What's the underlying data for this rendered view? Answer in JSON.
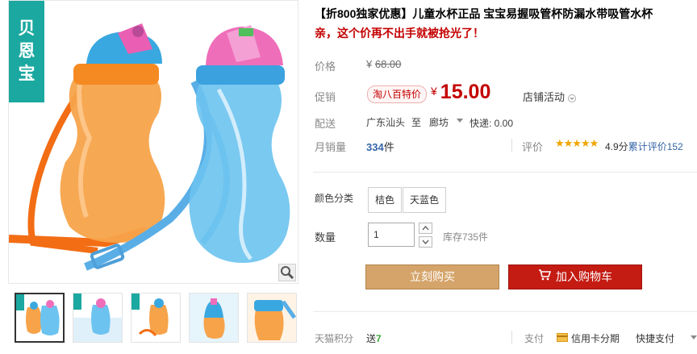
{
  "brand": {
    "chars": [
      "贝",
      "恩",
      "宝"
    ]
  },
  "product": {
    "title_prefix": "【折800独家优惠】",
    "title_main": "儿童水杯正品 宝宝易握吸管杯防漏水带吸管水杯",
    "subtitle": "亲，这个价再不出手就被抢光了！"
  },
  "price": {
    "label": "价格",
    "currency": "¥",
    "original": "68.00"
  },
  "promo": {
    "label": "促销",
    "badge": "淘八百特价",
    "currency": "¥",
    "value": "15.00",
    "shop_activity": "店铺活动"
  },
  "shipping": {
    "label": "配送",
    "from": "广东汕头",
    "to": "至",
    "city": "廊坊",
    "fee": "快递: 0.00"
  },
  "sales": {
    "label": "月销量",
    "count": "334",
    "unit": "件"
  },
  "reviews": {
    "label": "评价",
    "stars": "★★★★★",
    "score": "4.9分",
    "count_text": "累计评价152"
  },
  "color": {
    "label": "颜色分类",
    "options": [
      "桔色",
      "天蓝色"
    ]
  },
  "quantity": {
    "label": "数量",
    "value": "1",
    "stock": "库存735件"
  },
  "actions": {
    "buy_now": "立刻购买",
    "add_to_cart": "加入购物车"
  },
  "points": {
    "label": "天猫积分",
    "prefix": "送",
    "value": "7"
  },
  "payment": {
    "label": "支付",
    "credit": "信用卡分期",
    "quick": "快捷支付"
  },
  "colors": {
    "brand_teal": "#1aa8a0",
    "price_red": "#c40000",
    "buy_button": "#d5a46a",
    "cart_button": "#c41b13",
    "star": "#f0a500",
    "link_blue": "#3565a8"
  },
  "icons": {
    "zoom": "magnifier-icon",
    "cart": "cart-icon",
    "credit": "credit-card-icon"
  }
}
